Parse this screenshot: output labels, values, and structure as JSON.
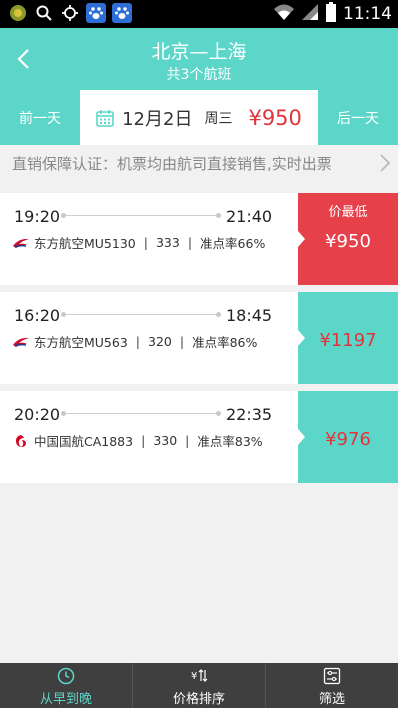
{
  "status_bar": {
    "time": "11:14"
  },
  "header": {
    "title": "北京—上海",
    "subtitle": "共3个航班"
  },
  "date_bar": {
    "prev_label": "前一天",
    "date": "12月2日",
    "weekday": "周三",
    "price": "¥950",
    "next_label": "后一天"
  },
  "notice": {
    "text": "直销保障认证：机票均由航司直接销售,实时出票"
  },
  "flights": [
    {
      "dep_time": "19:20",
      "arr_time": "21:40",
      "airline": "东方航空MU5130",
      "aircraft": "333",
      "on_time": "准点率66%",
      "badge": "价最低",
      "price": "¥950",
      "lowest": true,
      "logo_icon": "china-eastern-logo-icon"
    },
    {
      "dep_time": "16:20",
      "arr_time": "18:45",
      "airline": "东方航空MU563",
      "aircraft": "320",
      "on_time": "准点率86%",
      "badge": "",
      "price": "¥1197",
      "lowest": false,
      "logo_icon": "china-eastern-logo-icon"
    },
    {
      "dep_time": "20:20",
      "arr_time": "22:35",
      "airline": "中国国航CA1883",
      "aircraft": "330",
      "on_time": "准点率83%",
      "badge": "",
      "price": "¥976",
      "lowest": false,
      "logo_icon": "air-china-logo-icon"
    }
  ],
  "separator": "|",
  "bottom_tabs": [
    {
      "label": "从早到晚",
      "icon": "clock-icon",
      "active": true
    },
    {
      "label": "价格排序",
      "icon": "sort-price-icon",
      "active": false
    },
    {
      "label": "筛选",
      "icon": "filter-icon",
      "active": false
    }
  ],
  "colors": {
    "accent": "#5dd6ca",
    "price_red": "#e3333a",
    "lowest_bg": "#e6404b",
    "bottom_bar": "#3f3f3f"
  }
}
